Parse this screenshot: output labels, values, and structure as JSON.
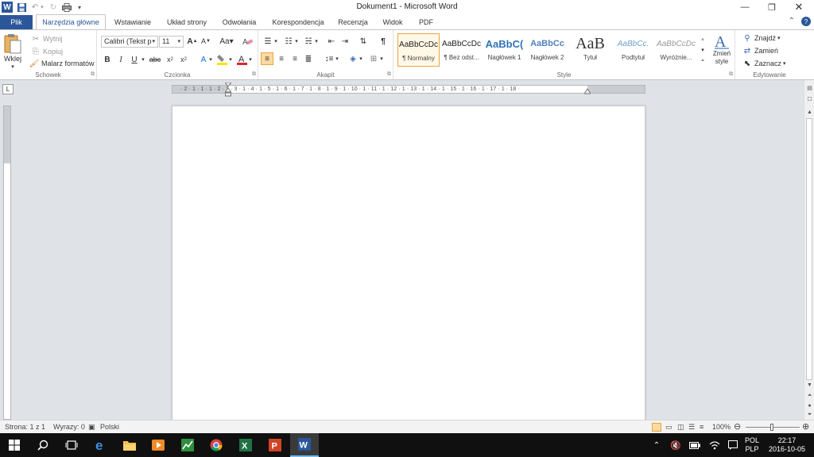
{
  "window": {
    "title": "Dokument1 - Microsoft Word",
    "minimize_icon": "minimize-icon",
    "restore_icon": "restore-icon",
    "close_icon": "close-icon"
  },
  "tabs": [
    {
      "label": "Plik"
    },
    {
      "label": "Narzędzia główne"
    },
    {
      "label": "Wstawianie"
    },
    {
      "label": "Układ strony"
    },
    {
      "label": "Odwołania"
    },
    {
      "label": "Korespondencja"
    },
    {
      "label": "Recenzja"
    },
    {
      "label": "Widok"
    },
    {
      "label": "PDF"
    }
  ],
  "clipboard": {
    "paste": "Wklej",
    "cut": "Wytnij",
    "copy": "Kopiuj",
    "format_painter": "Malarz formatów",
    "group": "Schowek"
  },
  "font": {
    "name": "Calibri (Tekst pc",
    "size": "11",
    "group": "Czcionka"
  },
  "paragraph": {
    "group": "Akapit"
  },
  "styles": {
    "group": "Style",
    "items": [
      {
        "sample": "AaBbCcDc",
        "name": "¶ Normalny"
      },
      {
        "sample": "AaBbCcDc",
        "name": "¶ Bez odst..."
      },
      {
        "sample": "AaBbC(",
        "name": "Nagłówek 1"
      },
      {
        "sample": "AaBbCc",
        "name": "Nagłówek 2"
      },
      {
        "sample": "AaB",
        "name": "Tytuł"
      },
      {
        "sample": "AaBbCc.",
        "name": "Podtytuł"
      },
      {
        "sample": "AaBbCcDc",
        "name": "Wyróżnie..."
      }
    ],
    "change_styles": "Zmień style"
  },
  "editing": {
    "find": "Znajdź",
    "replace": "Zamień",
    "select": "Zaznacz",
    "group": "Edytowanie"
  },
  "ruler": {
    "numbers": "· 2 · 1 · 1 · 1 · 2 · 1 · 3 · 1 · 4 · 1 · 5 · 1 · 6 · 1 · 7 · 1 · 8 · 1 · 9 · 1 · 10 · 1 · 11 · 1 · 12 · 1 · 13 · 1 · 14 · 1 · 15 · 1 · 16 · 1 · 17 · 1 · 18 ·",
    "tab_selector": "L"
  },
  "status": {
    "page": "Strona: 1 z 1",
    "words": "Wyrazy: 0",
    "language": "Polski",
    "zoom": "100%"
  },
  "taskbar": {
    "lang_top": "POL",
    "lang_bottom": "PLP",
    "time": "22:17",
    "date": "2016-10-05"
  },
  "colors": {
    "accent": "#2b579a",
    "highlight": "#fcd9a0",
    "font_color": "#e0242b",
    "highlight_color": "#f7e300"
  }
}
